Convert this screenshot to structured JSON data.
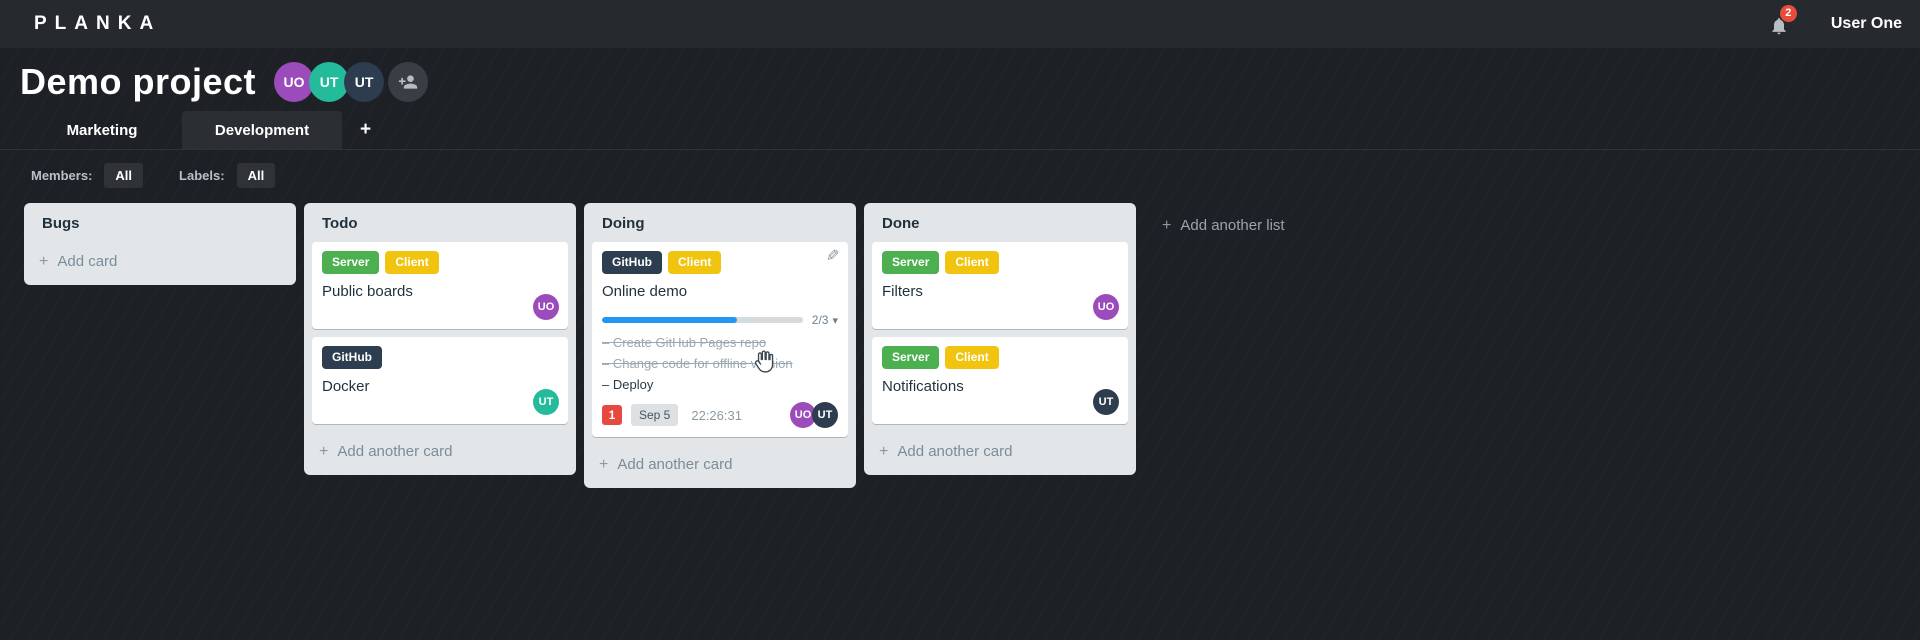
{
  "app": {
    "logo": "PLANKA",
    "user_name": "User One",
    "notifications_count": "2"
  },
  "project": {
    "title": "Demo project",
    "members": [
      {
        "initials": "UO",
        "color": "#9b4bba"
      },
      {
        "initials": "UT",
        "color": "#24bb9b"
      },
      {
        "initials": "UT",
        "color": "#2d3c4e"
      }
    ]
  },
  "tabs": [
    {
      "label": "Marketing"
    },
    {
      "label": "Development"
    }
  ],
  "filters": {
    "members_label": "Members:",
    "members_value": "All",
    "labels_label": "Labels:",
    "labels_value": "All"
  },
  "board": {
    "add_list_label": "Add another list",
    "lists": [
      {
        "title": "Bugs",
        "footer_label": "Add card",
        "cards": []
      },
      {
        "title": "Todo",
        "footer_label": "Add another card",
        "cards": [
          {
            "title": "Public boards",
            "labels": [
              {
                "text": "Server",
                "color": "#4caf50"
              },
              {
                "text": "Client",
                "color": "#f1c40f"
              }
            ],
            "members": [
              {
                "initials": "UO",
                "color": "#9b4bba"
              }
            ]
          },
          {
            "title": "Docker",
            "labels": [
              {
                "text": "GitHub",
                "color": "#2c3e50"
              }
            ],
            "members": [
              {
                "initials": "UT",
                "color": "#24bb9b"
              }
            ]
          }
        ]
      },
      {
        "title": "Doing",
        "footer_label": "Add another card",
        "cards": [
          {
            "title": "Online demo",
            "labels": [
              {
                "text": "GitHub",
                "color": "#2c3e50"
              },
              {
                "text": "Client",
                "color": "#f1c40f"
              }
            ],
            "progress": {
              "done": 2,
              "total": 3,
              "text": "2/3",
              "percent": 67,
              "bar_color": "#2196f3"
            },
            "tasks": [
              {
                "text": "Create GitHub Pages repo",
                "completed": true
              },
              {
                "text": "Change code for offline version",
                "completed": true
              },
              {
                "text": "Deploy",
                "completed": false
              }
            ],
            "notification_count": "1",
            "due_date": "Sep 5",
            "timer": "22:26:31",
            "members": [
              {
                "initials": "UO",
                "color": "#9b4bba"
              },
              {
                "initials": "UT",
                "color": "#2d3c4e"
              }
            ]
          }
        ]
      },
      {
        "title": "Done",
        "footer_label": "Add another card",
        "cards": [
          {
            "title": "Filters",
            "labels": [
              {
                "text": "Server",
                "color": "#4caf50"
              },
              {
                "text": "Client",
                "color": "#f1c40f"
              }
            ],
            "members": [
              {
                "initials": "UO",
                "color": "#9b4bba"
              }
            ]
          },
          {
            "title": "Notifications",
            "labels": [
              {
                "text": "Server",
                "color": "#4caf50"
              },
              {
                "text": "Client",
                "color": "#f1c40f"
              }
            ],
            "members": [
              {
                "initials": "UT",
                "color": "#2d3c4e"
              }
            ]
          }
        ]
      }
    ]
  },
  "icons": {
    "plus": "+",
    "caret_down": "▾",
    "pencil": "✎",
    "task_bullet": "–"
  }
}
